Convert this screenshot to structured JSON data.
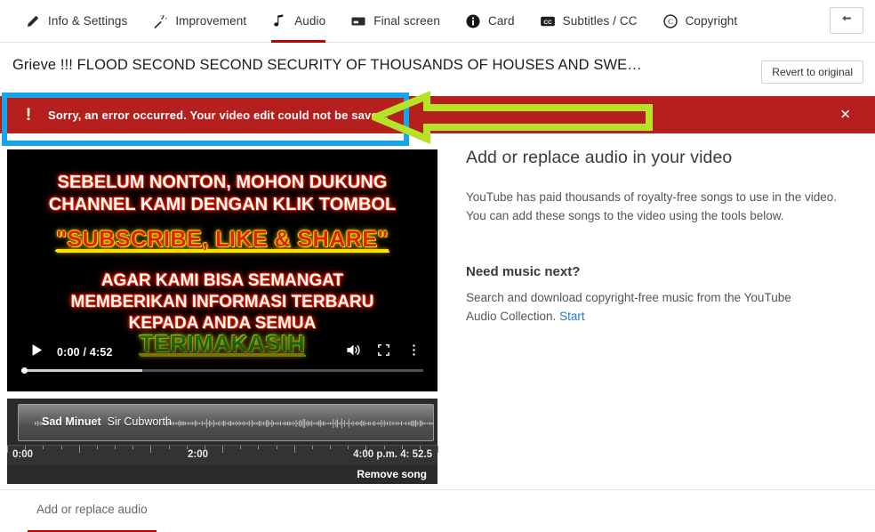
{
  "nav": {
    "tabs": [
      {
        "label": "Info & Settings",
        "icon": "pencil-icon",
        "active": false
      },
      {
        "label": "Improvement",
        "icon": "magic-wand-icon",
        "active": false
      },
      {
        "label": "Audio",
        "icon": "music-note-icon",
        "active": true
      },
      {
        "label": "Final screen",
        "icon": "final-screen-icon",
        "active": false
      },
      {
        "label": "Card",
        "icon": "info-circle-icon",
        "active": false
      },
      {
        "label": "Subtitles / CC",
        "icon": "cc-icon",
        "active": false
      },
      {
        "label": "Copyright",
        "icon": "copyright-icon",
        "active": false
      }
    ],
    "back_button_icon": "back-arrow-icon"
  },
  "title": {
    "video_title": "Grieve !!! FLOOD SECOND SECOND SECURITY OF THOUSANDS OF HOUSES AND SWE…",
    "revert_label": "Revert to original"
  },
  "error": {
    "icon": "exclamation-icon",
    "message": "Sorry, an error occurred. Your video edit could not be saved.",
    "close_icon": "✕",
    "background_color": "#b5201f"
  },
  "annotations": {
    "highlight_box_color": "#16a6e8",
    "arrow_color": "#b5e326",
    "arrow_direction": "left"
  },
  "video": {
    "overlay_line1": "SEBELUM NONTON, MOHON DUKUNG",
    "overlay_line2": "CHANNEL KAMI DENGAN KLIK TOMBOL",
    "overlay_subscribe": "\"SUBSCRIBE, LIKE & SHARE\"",
    "overlay_line3": "AGAR KAMI BISA SEMANGAT",
    "overlay_line4": "MEMBERIKAN INFORMASI TERBARU",
    "overlay_line5": "KEPADA ANDA SEMUA",
    "overlay_thanks": "TERIMAKASIH",
    "controls": {
      "play_icon": "play-icon",
      "time": "0:00 / 4:52",
      "volume_icon": "volume-icon",
      "fullscreen_icon": "fullscreen-icon",
      "more_icon": "more-vertical-icon",
      "progress_percent": 0,
      "loaded_percent": 30
    }
  },
  "audio_track": {
    "song_title": "Sad Minuet",
    "song_artist": "Sir Cubworth",
    "ruler_start": "0:00",
    "ruler_mid": "2:00",
    "ruler_end": "4:00 p.m.  4: 52.5",
    "remove_label": "Remove song"
  },
  "right_panel": {
    "heading": "Add or replace audio in your video",
    "paragraph": "YouTube has paid thousands of royalty-free songs to use in the video. You can add these songs to the video using the tools below.",
    "subheading": "Need music next?",
    "paragraph2": "Search and download copyright-free music from the YouTube Audio Collection. ",
    "link_label": "Start"
  },
  "bottom_tab": {
    "label": "Add or replace audio"
  }
}
